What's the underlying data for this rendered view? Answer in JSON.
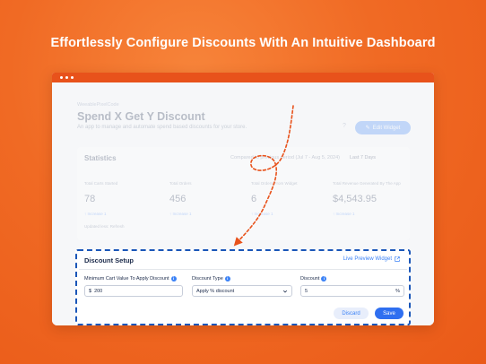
{
  "headline": "Effortlessly Configure Discounts With An Intuitive Dashboard",
  "colors": {
    "brand_orange": "#f06a24",
    "accent_blue": "#2f6ff0",
    "dashed_border": "#1a56b8",
    "arrow": "#e8521b"
  },
  "app": {
    "brand": "WeeablePixelCode",
    "title": "Spend X Get Y Discount",
    "subtitle": "An app to manage and automate spend based discounts for your store.",
    "help_icon": "question-circle-icon",
    "edit_widget_label": "Edit Widget"
  },
  "stats": {
    "title": "Statistics",
    "compare_text": "Compared to previous period (Jul 7 - Aug 5, 2024)",
    "range": "Last 7 Days",
    "metrics": [
      {
        "label": "Total Carts Started",
        "value": "78",
        "change": "↑ Increase 1"
      },
      {
        "label": "Total Orders",
        "value": "456",
        "change": "↑ Increase 1"
      },
      {
        "label": "Total Orders From Widget",
        "value": "6",
        "change": "↑ Increase 1"
      },
      {
        "label": "Total Revenue Generated By The App",
        "value": "$4,543.95",
        "change": "↑ Increase 1"
      }
    ],
    "updated": "Updated less: Refresh"
  },
  "setup": {
    "title": "Discount Setup",
    "live_preview": "Live Preview Widget",
    "fields": {
      "min_cart": {
        "label": "Minimum Cart Value To Apply Discount",
        "prefix": "$",
        "value": "200"
      },
      "type": {
        "label": "Discount Type",
        "value": "Apply % discount"
      },
      "discount": {
        "label": "Discount",
        "value": "5",
        "suffix": "%"
      }
    },
    "discard_label": "Discard",
    "save_label": "Save"
  }
}
